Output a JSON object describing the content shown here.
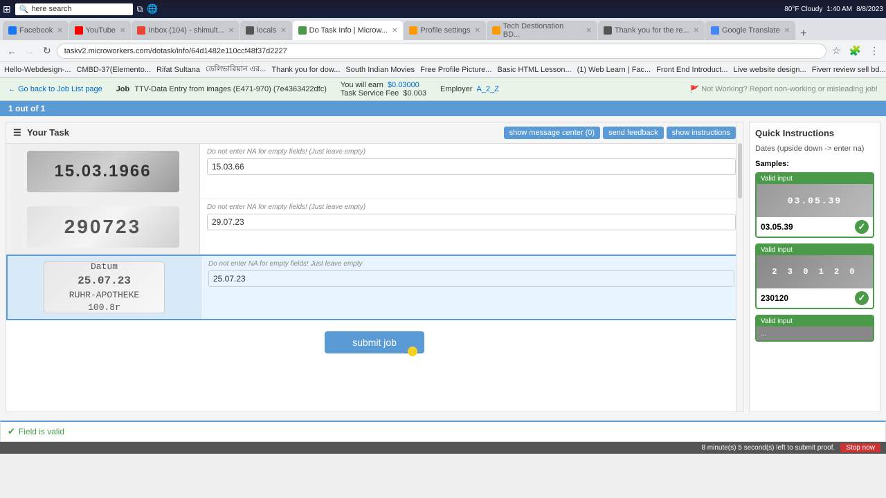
{
  "os": {
    "search_placeholder": "here search",
    "time": "1:40 AM",
    "date": "8/8/2023",
    "weather": "80°F Cloudy"
  },
  "browser": {
    "tabs": [
      {
        "id": "facebook",
        "label": "Facebook",
        "active": false,
        "color": "#1877f2"
      },
      {
        "id": "youtube",
        "label": "YouTube",
        "active": false,
        "color": "#ff0000"
      },
      {
        "id": "inbox",
        "label": "Inbox (104) - shimult...",
        "active": false,
        "color": "#ea4335"
      },
      {
        "id": "locals",
        "label": "locals",
        "active": false,
        "color": "#555"
      },
      {
        "id": "dotask",
        "label": "Do Task Info | Microw...",
        "active": true,
        "color": "#4a9a4a"
      },
      {
        "id": "profile",
        "label": "Profile settings",
        "active": false,
        "color": "#f90"
      },
      {
        "id": "tech",
        "label": "Tech Destionation BD...",
        "active": false,
        "color": "#f90"
      },
      {
        "id": "thankyou",
        "label": "Thank you for the re...",
        "active": false,
        "color": "#555"
      },
      {
        "id": "translate",
        "label": "Google Translate",
        "active": false,
        "color": "#4285f4"
      }
    ],
    "address": "taskv2.microworkers.com/dotask/info/64d1482e110ccf48f37d2227",
    "bookmarks": [
      "Hello-Webdesign-...",
      "CMBD-37(Elemento...",
      "Rifat Sultana",
      "ডেলিভারিয়ান এর...",
      "Thank you for dow...",
      "South Indian Movies",
      "Free Profile Picture...",
      "Basic HTML Lesson...",
      "(1) Web Learn | Fac...",
      "Front End Introduct...",
      "Live website design...",
      "Fiverr review sell bd..."
    ]
  },
  "job_info": {
    "back_label": "Go back to Job List page",
    "job_label": "Job",
    "job_name": "TTV-Data Entry from images (E471-970) (7e4363422dfc)",
    "earn_label": "You will earn",
    "earn_amount": "$0.03000",
    "fee_label": "Task Service Fee",
    "fee_amount": "$0.003",
    "employer_label": "Employer",
    "employer_name": "A_2_Z",
    "report_label": "Not Working? Report non-working or misleading job!"
  },
  "counter": {
    "text": "1 out of 1"
  },
  "task": {
    "title": "Your Task",
    "header_buttons": {
      "message_center": "show message center (0)",
      "feedback": "send feedback",
      "instructions": "show instructions"
    },
    "rows": [
      {
        "id": "row1",
        "image_text": "15.03.1966",
        "hint": "Do not enter NA for empty fields! (Just leave empty)",
        "value": "15.03.66"
      },
      {
        "id": "row2",
        "image_text": "290723",
        "hint": "Do not enter NA for empty fields! (Just leave empty)",
        "value": "29.07.23"
      },
      {
        "id": "row3",
        "image_text": "Datum\n25.07.23\nRUHR-APOTHEKE\n100.8r",
        "hint": "Do not enter NA for empty fields! Just leave empty",
        "value": "25.07.23",
        "highlighted": true
      }
    ],
    "submit_label": "submit job",
    "field_valid": "Field is valid"
  },
  "quick_instructions": {
    "title": "Quick Instructions",
    "text": "Dates (upside down -> enter na)",
    "samples_label": "Samples:",
    "samples": [
      {
        "id": "sample1",
        "label": "Valid input",
        "img_text": "03.05.39",
        "value": "03.05.39"
      },
      {
        "id": "sample2",
        "label": "Valid input",
        "img_text": "2 3 0 1 2 0",
        "value": "230120"
      },
      {
        "id": "sample3",
        "label": "Valid input",
        "img_text": "...",
        "value": ""
      }
    ]
  },
  "timer": {
    "text": "8 minute(s) 5 second(s) left to submit proof.",
    "stop_label": "Stop now"
  }
}
